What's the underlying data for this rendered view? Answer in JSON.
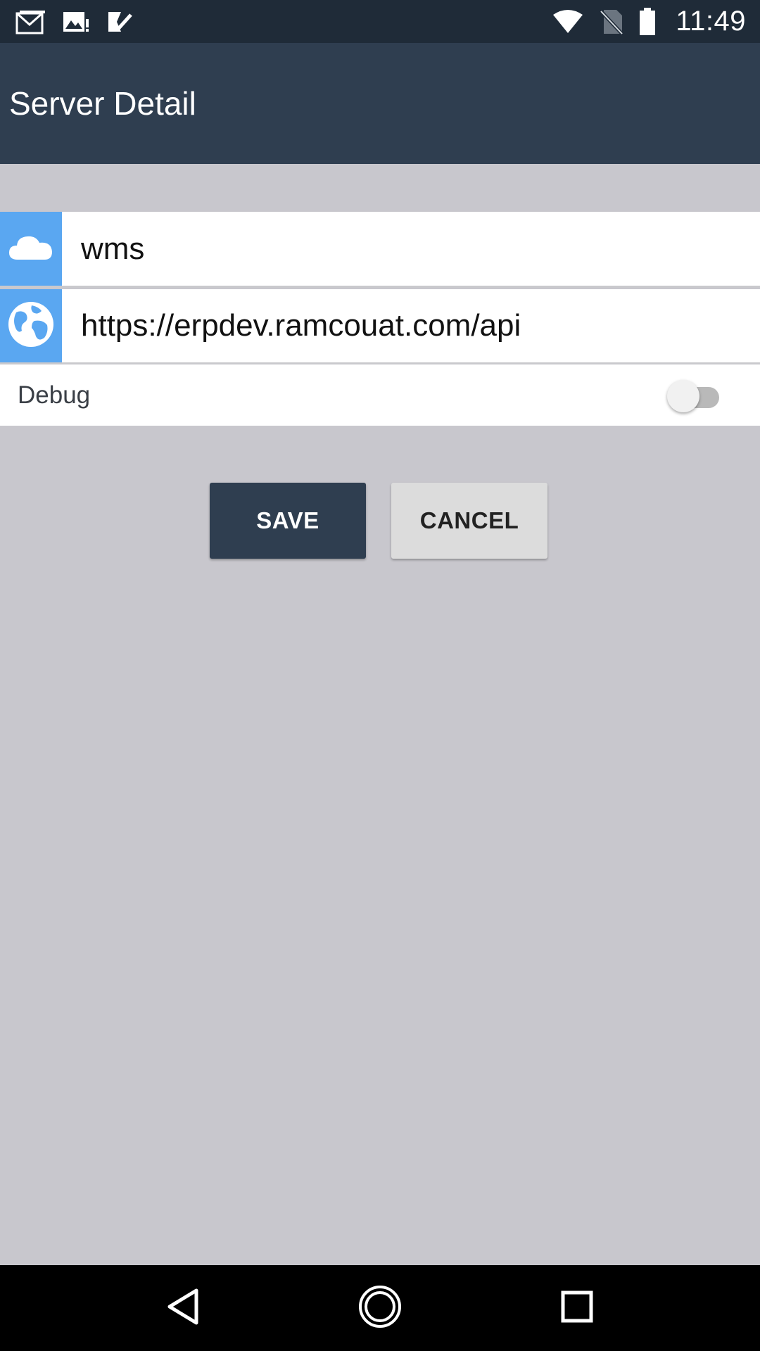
{
  "status_bar": {
    "time": "11:49",
    "left_icons": [
      "gmail-icon",
      "image-alert-icon",
      "task-check-icon"
    ],
    "right_icons": [
      "wifi-icon",
      "no-sim-icon",
      "battery-icon"
    ]
  },
  "toolbar": {
    "title": "Server Detail"
  },
  "form": {
    "name_value": "wms",
    "url_value": "https://erpdev.ramcouat.com/api",
    "debug_label": "Debug",
    "debug_enabled": false
  },
  "actions": {
    "save_label": "SAVE",
    "cancel_label": "CANCEL"
  },
  "colors": {
    "status_bar": "#1f2b38",
    "toolbar": "#2f3e50",
    "icon_bg": "#5aa7f1",
    "background": "#c8c7cd"
  }
}
